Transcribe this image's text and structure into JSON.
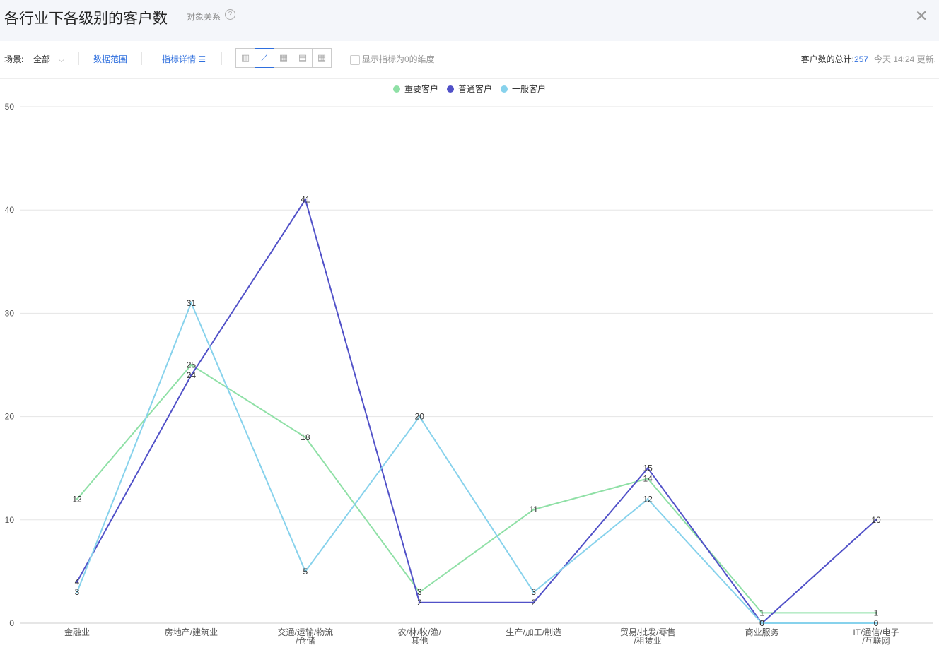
{
  "header": {
    "title": "各行业下各级别的客户数",
    "subtitle": "对象关系",
    "help_icon": "question-circle-icon",
    "close_icon": "close-icon"
  },
  "toolbar": {
    "scene_label": "场景:",
    "scene_value": "全部",
    "data_range": "数据范围",
    "metric_detail": "指标详情",
    "metric_icon": "list-icon",
    "view_buttons": [
      "bar-chart-icon",
      "line-chart-icon",
      "heatmap-icon",
      "pivot-table-icon",
      "table-icon"
    ],
    "active_view": "line-chart-icon",
    "show_zero_label": "显示指标为0的维度",
    "total_label": "客户数的总计:",
    "total_value": "257",
    "updated": "今天 14:24 更新."
  },
  "chart_data": {
    "type": "line",
    "categories": [
      "金融业",
      "房地产/建筑业",
      "交通/运输/物流/仓储",
      "农/林/牧/渔/其他",
      "生产/加工/制造",
      "贸易/批发/零售/租赁业",
      "商业服务",
      "IT/通信/电子/互联网"
    ],
    "category_lines": [
      [
        "金融业"
      ],
      [
        "房地产/建筑业"
      ],
      [
        "交通/运输/物流",
        "/仓储"
      ],
      [
        "农/林/牧/渔/",
        "其他"
      ],
      [
        "生产/加工/制造"
      ],
      [
        "贸易/批发/零售",
        "/租赁业"
      ],
      [
        "商业服务"
      ],
      [
        "IT/通信/电子",
        "/互联网"
      ]
    ],
    "series": [
      {
        "name": "重要客户",
        "color": "#8fe0a6",
        "values": [
          12,
          25,
          18,
          3,
          11,
          14,
          1,
          1
        ]
      },
      {
        "name": "普通客户",
        "color": "#5151c8",
        "values": [
          4,
          24,
          41,
          2,
          2,
          15,
          0,
          10
        ]
      },
      {
        "name": "一般客户",
        "color": "#87d2ec",
        "values": [
          3,
          31,
          5,
          20,
          3,
          12,
          0,
          0
        ]
      }
    ],
    "ylim": [
      0,
      50
    ],
    "yticks": [
      0,
      10,
      20,
      30,
      40,
      50
    ],
    "grid": true,
    "legend": "top-center",
    "data_labels": true
  }
}
